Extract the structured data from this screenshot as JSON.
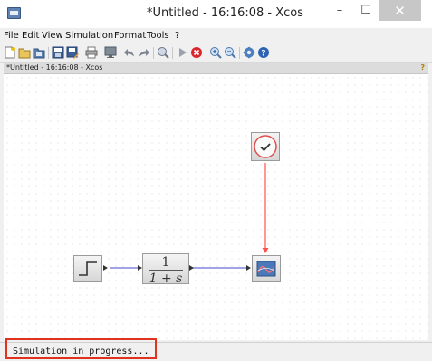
{
  "window": {
    "title": "*Untitled - 16:16:08 - Xcos",
    "min_glyph": "–",
    "max_glyph": "☐",
    "close_glyph": "✕"
  },
  "menu": [
    "File",
    "Edit",
    "View",
    "Simulation",
    "Format",
    "Tools",
    "?"
  ],
  "toolbar": {
    "icons": [
      "new-icon",
      "open-icon",
      "open-in-scilab-icon",
      "save-icon",
      "save-as-icon",
      "print-icon",
      "export-icon",
      "undo-icon",
      "redo-icon",
      "fit-diagram-icon",
      "start-icon",
      "stop-icon",
      "zoom-in-icon",
      "zoom-out-icon",
      "palette-browser-icon",
      "help-icon"
    ]
  },
  "document": {
    "label": "*Untitled - 16:16:08 - Xcos",
    "help_glyph": "?"
  },
  "blocks": {
    "transfer_function": {
      "numerator": "1",
      "denominator": "1 + s"
    }
  },
  "status": {
    "text": "Simulation in progress..."
  },
  "colors": {
    "link_regular": "#6b6bd6",
    "link_activation": "#ff5050",
    "highlight": "#e0321e"
  }
}
